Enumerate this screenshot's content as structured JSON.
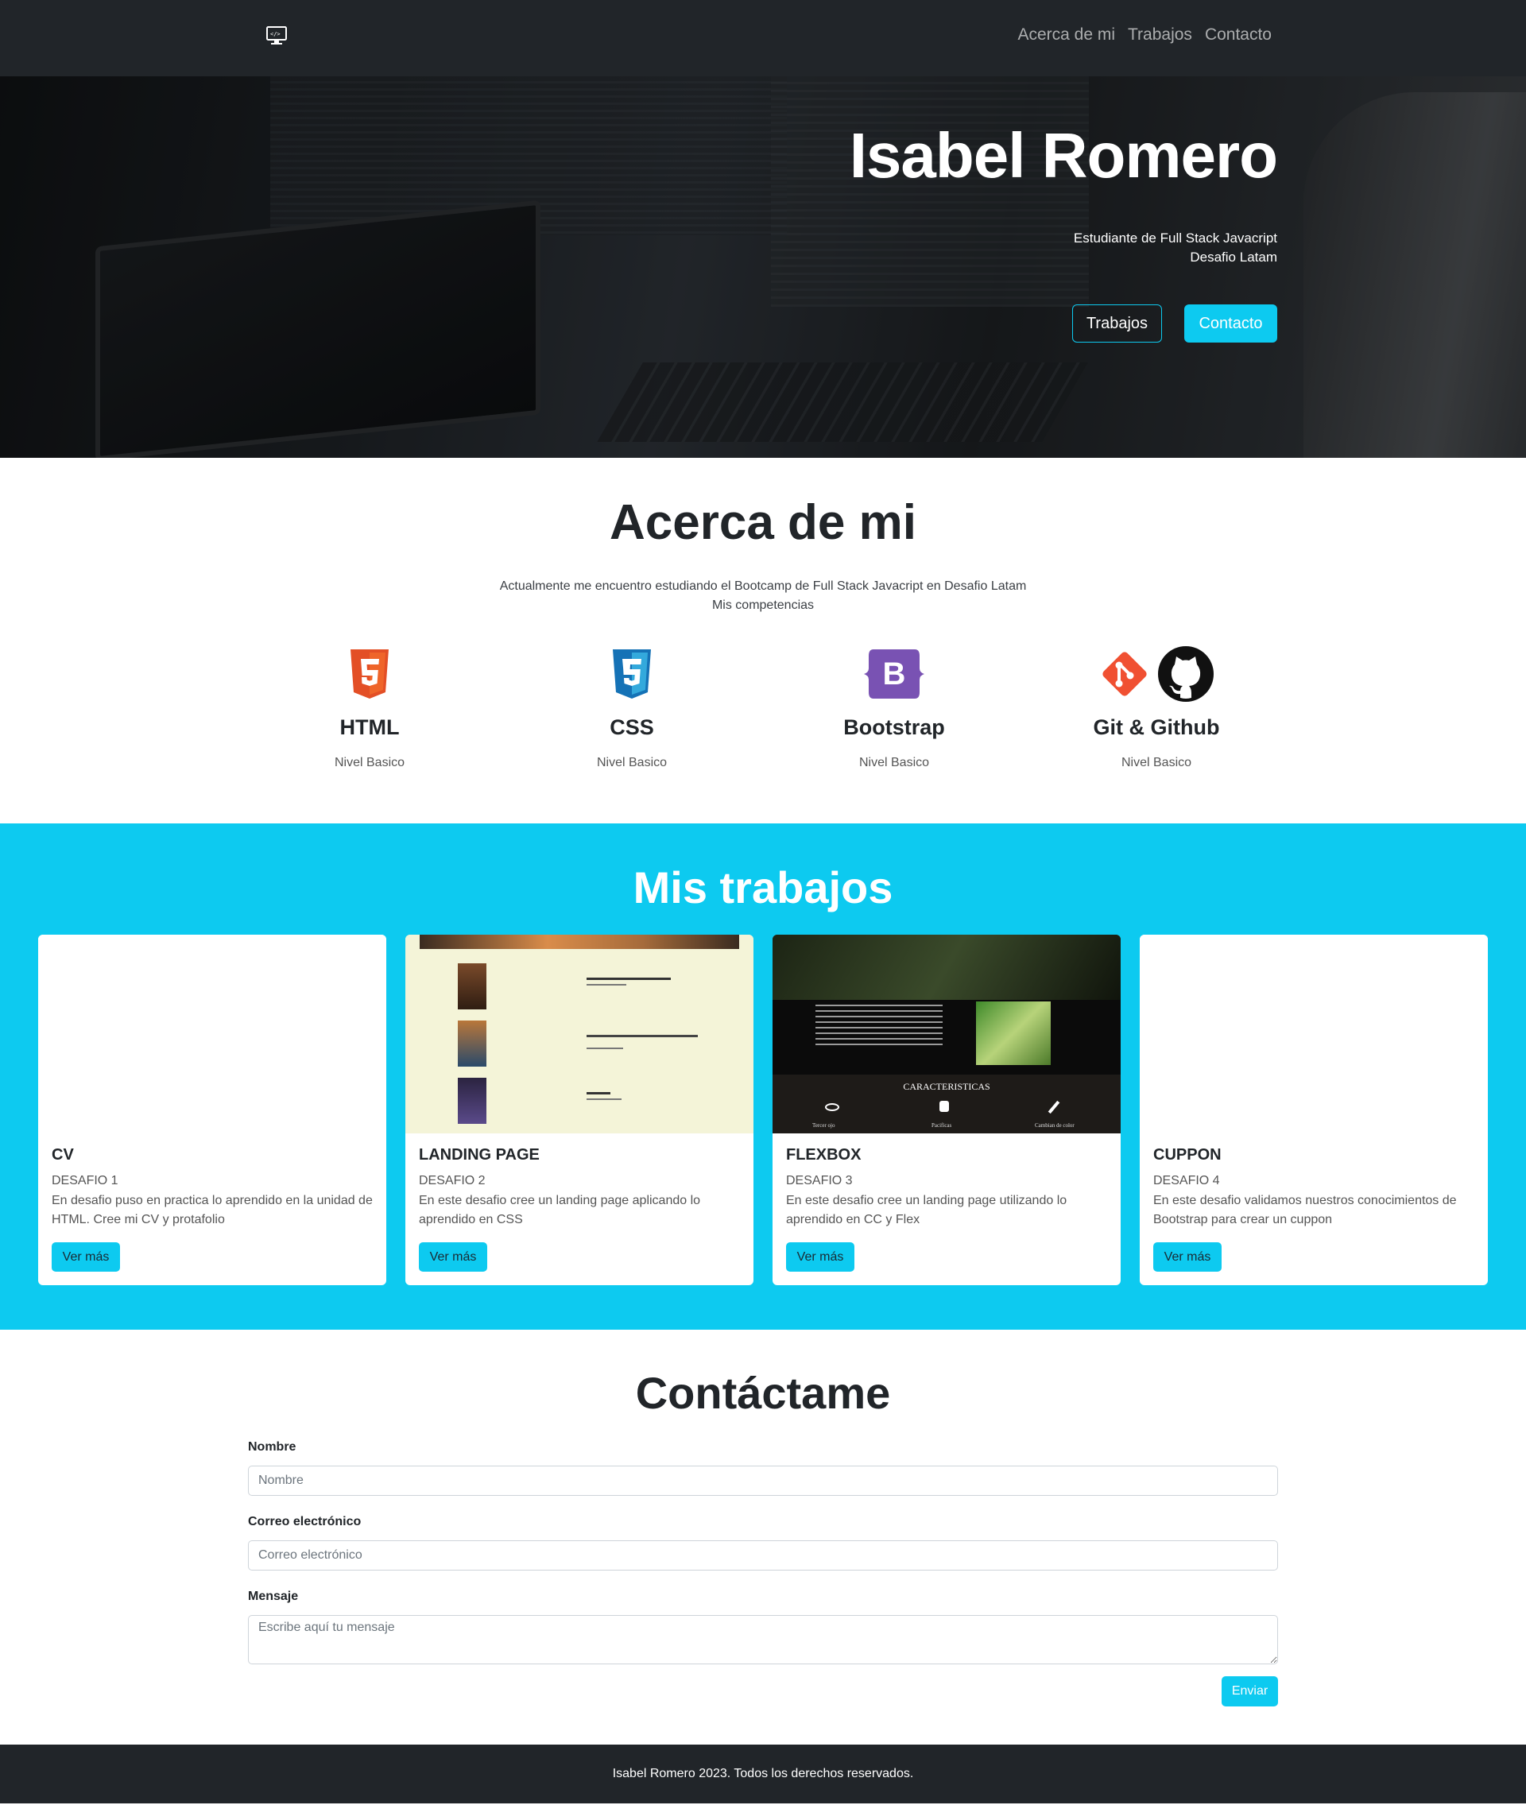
{
  "nav": {
    "logo_icon": "computer-icon",
    "links": [
      "Acerca de mi",
      "Trabajos",
      "Contacto"
    ]
  },
  "hero": {
    "title": "Isabel Romero",
    "subtitle_line1": "Estudiante de Full Stack Javacript",
    "subtitle_line2": "Desafio Latam",
    "btn_works": "Trabajos",
    "btn_contact": "Contacto"
  },
  "about": {
    "title": "Acerca de mi",
    "text_line1": "Actualmente me encuentro estudiando el Bootcamp de Full Stack Javacript en Desafio Latam",
    "text_line2": "Mis competencias",
    "skills": [
      {
        "name": "HTML",
        "level": "Nivel Basico",
        "icon": "html5-icon",
        "color": "#e34f26"
      },
      {
        "name": "CSS",
        "level": "Nivel Basico",
        "icon": "css3-icon",
        "color": "#1572b6"
      },
      {
        "name": "Bootstrap",
        "level": "Nivel Basico",
        "icon": "bootstrap-icon",
        "color": "#7952b3"
      },
      {
        "name": "Git & Github",
        "level": "Nivel Basico",
        "icon": "git-github-icon",
        "color": "#f05032"
      }
    ]
  },
  "works": {
    "title": "Mis trabajos",
    "cards": [
      {
        "title": "CV",
        "subtitle": "DESAFIO 1",
        "desc": "En desafio puso en practica lo aprendido en la unidad de HTML. Cree mi CV y protafolio",
        "button": "Ver más"
      },
      {
        "title": "LANDING PAGE",
        "subtitle": "DESAFIO 2",
        "desc": "En este desafio cree un landing page aplicando lo aprendido en CSS",
        "button": "Ver más"
      },
      {
        "title": "FLEXBOX",
        "subtitle": "DESAFIO 3",
        "desc": "En este desafio cree un landing page utilizando lo aprendido en CC y Flex",
        "button": "Ver más",
        "thumb_heading": "CARACTERISTICAS",
        "thumb_items": [
          "Tercer ojo",
          "Pacificas",
          "Cambian de color"
        ]
      },
      {
        "title": "CUPPON",
        "subtitle": "DESAFIO 4",
        "desc": "En este desafio validamos nuestros conocimientos de Bootstrap para crear un cuppon",
        "button": "Ver más"
      }
    ]
  },
  "contact": {
    "title": "Contáctame",
    "name_label": "Nombre",
    "name_placeholder": "Nombre",
    "email_label": "Correo electrónico",
    "email_placeholder": "Correo electrónico",
    "message_label": "Mensaje",
    "message_placeholder": "Escribe aquí tu mensaje",
    "submit": "Enviar"
  },
  "footer": {
    "text": "Isabel Romero 2023. Todos los derechos reservados."
  },
  "colors": {
    "dark": "#212529",
    "accent": "#0dcaf0"
  }
}
